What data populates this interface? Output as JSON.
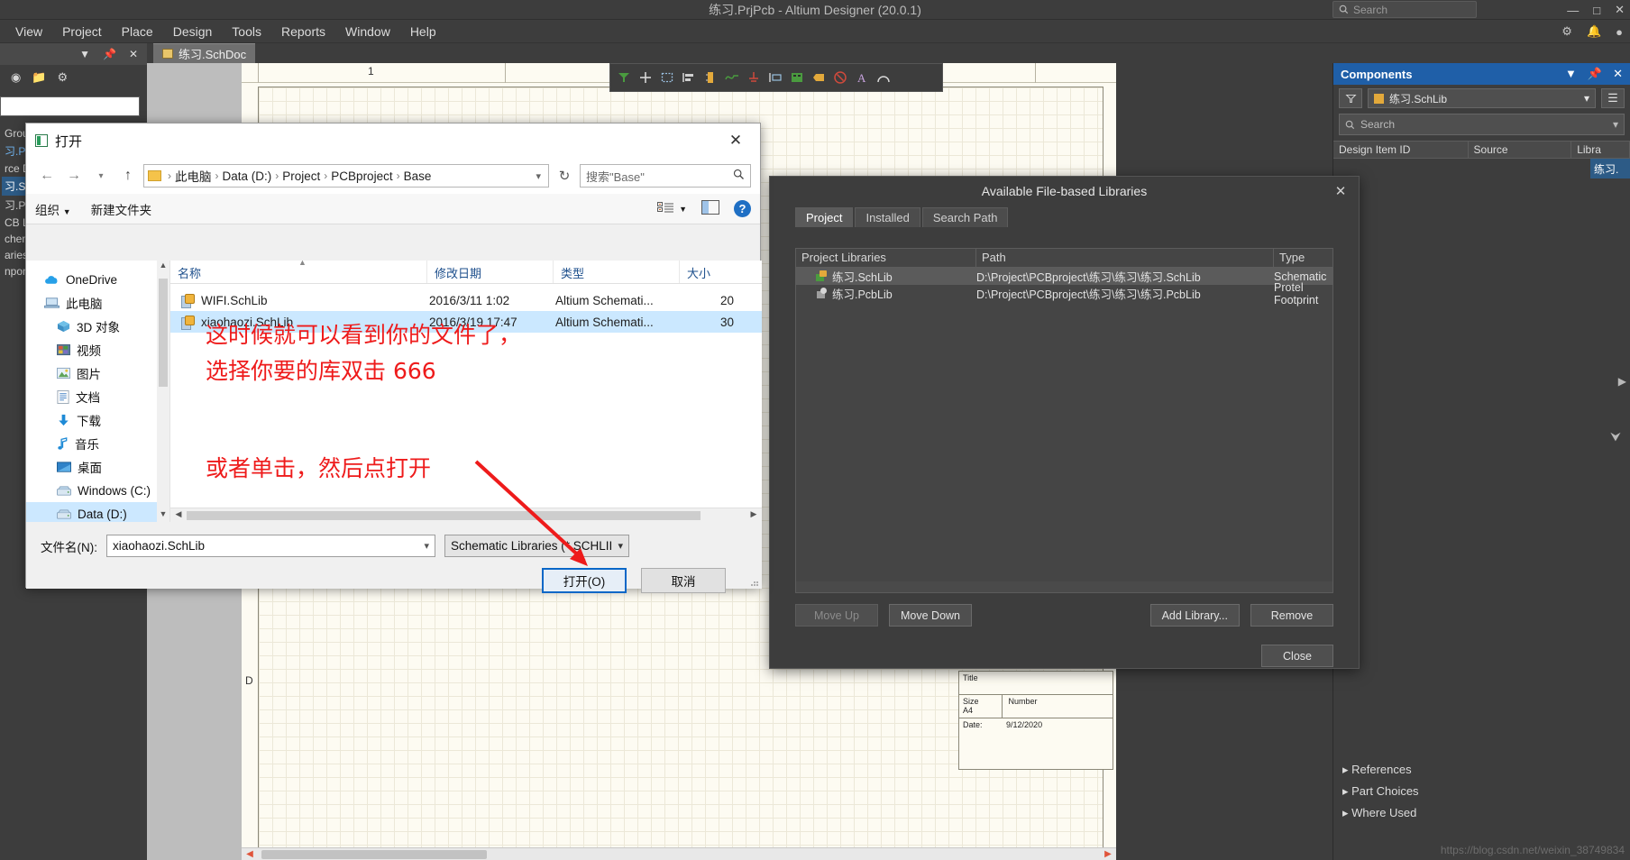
{
  "app": {
    "title": "练习.PrjPcb - Altium Designer (20.0.1)",
    "search_placeholder": "Search",
    "menu": [
      "View",
      "Project",
      "Place",
      "Design",
      "Tools",
      "Reports",
      "Window",
      "Help"
    ],
    "doc_tab": "练习.SchDoc"
  },
  "left_panel": {
    "tree": [
      "Grou",
      "习.PrjPc",
      "rce D",
      "习.S",
      "习.P",
      "CB Li",
      "chem",
      "aries",
      "npon"
    ]
  },
  "canvas": {
    "ruler_numbers": [
      "1"
    ],
    "row_label": "D",
    "title_block": {
      "title_label": "Title",
      "size_label": "Size",
      "size_value": "A4",
      "number_label": "Number",
      "date_label": "Date:",
      "date_value": "9/12/2020"
    }
  },
  "components_panel": {
    "header": "Components",
    "library_value": "练习.SchLib",
    "search_placeholder": "Search",
    "columns": [
      "Design Item ID",
      "Source",
      "Libra"
    ],
    "selected_cell": "练习.",
    "sections": [
      "References",
      "Part Choices",
      "Where Used"
    ],
    "watermark": "https://blog.csdn.net/weixin_38749834"
  },
  "open_dialog": {
    "title": "打开",
    "breadcrumb": [
      "此电脑",
      "Data (D:)",
      "Project",
      "PCBproject",
      "Base"
    ],
    "search_placeholder": "搜索\"Base\"",
    "toolbar": {
      "organize": "组织",
      "new_folder": "新建文件夹"
    },
    "sidebar": [
      {
        "label": "OneDrive",
        "icon": "onedrive-icon",
        "level": 1,
        "selected": false
      },
      {
        "label": "此电脑",
        "icon": "computer-icon",
        "level": 1,
        "selected": false
      },
      {
        "label": "3D 对象",
        "icon": "3d-objects-icon",
        "level": 2,
        "selected": false
      },
      {
        "label": "视频",
        "icon": "videos-icon",
        "level": 2,
        "selected": false
      },
      {
        "label": "图片",
        "icon": "pictures-icon",
        "level": 2,
        "selected": false
      },
      {
        "label": "文档",
        "icon": "documents-icon",
        "level": 2,
        "selected": false
      },
      {
        "label": "下载",
        "icon": "downloads-icon",
        "level": 2,
        "selected": false
      },
      {
        "label": "音乐",
        "icon": "music-icon",
        "level": 2,
        "selected": false
      },
      {
        "label": "桌面",
        "icon": "desktop-icon",
        "level": 2,
        "selected": false
      },
      {
        "label": "Windows (C:)",
        "icon": "drive-icon",
        "level": 2,
        "selected": false
      },
      {
        "label": "Data (D:)",
        "icon": "drive-icon",
        "level": 2,
        "selected": true
      }
    ],
    "columns": [
      "名称",
      "修改日期",
      "类型",
      "大小"
    ],
    "files": [
      {
        "name": "WIFI.SchLib",
        "modified": "2016/3/11 1:02",
        "type": "Altium Schemati...",
        "size": "20",
        "selected": false
      },
      {
        "name": "xiaohaozi.SchLib",
        "modified": "2016/3/19 17:47",
        "type": "Altium Schemati...",
        "size": "30",
        "selected": true
      }
    ],
    "filename_label": "文件名(N):",
    "filename_value": "xiaohaozi.SchLib",
    "filetype_value": "Schematic Libraries (*.SCHLII",
    "open_button": "打开(O)",
    "cancel_button": "取消"
  },
  "libraries_dialog": {
    "title": "Available File-based Libraries",
    "tabs": [
      "Project",
      "Installed",
      "Search Path"
    ],
    "active_tab": "Project",
    "columns": [
      "Project Libraries",
      "Path",
      "Type"
    ],
    "rows": [
      {
        "name": "练习.SchLib",
        "path": "D:\\Project\\PCBproject\\练习\\练习\\练习.SchLib",
        "type": "Schematic",
        "icon": "schlib-icon",
        "selected": true
      },
      {
        "name": "练习.PcbLib",
        "path": "D:\\Project\\PCBproject\\练习\\练习\\练习.PcbLib",
        "type": "Protel Footprint",
        "icon": "pcblib-icon",
        "selected": false
      }
    ],
    "buttons": {
      "move_up": "Move Up",
      "move_down": "Move Down",
      "add_library": "Add Library...",
      "remove": "Remove",
      "close": "Close"
    }
  },
  "annotations": {
    "line1": "这时候就可以看到你的文件了，",
    "line2": "选择你要的库双击 666",
    "line3": "或者单击，然后点打开",
    "color": "#ee1b1b"
  }
}
